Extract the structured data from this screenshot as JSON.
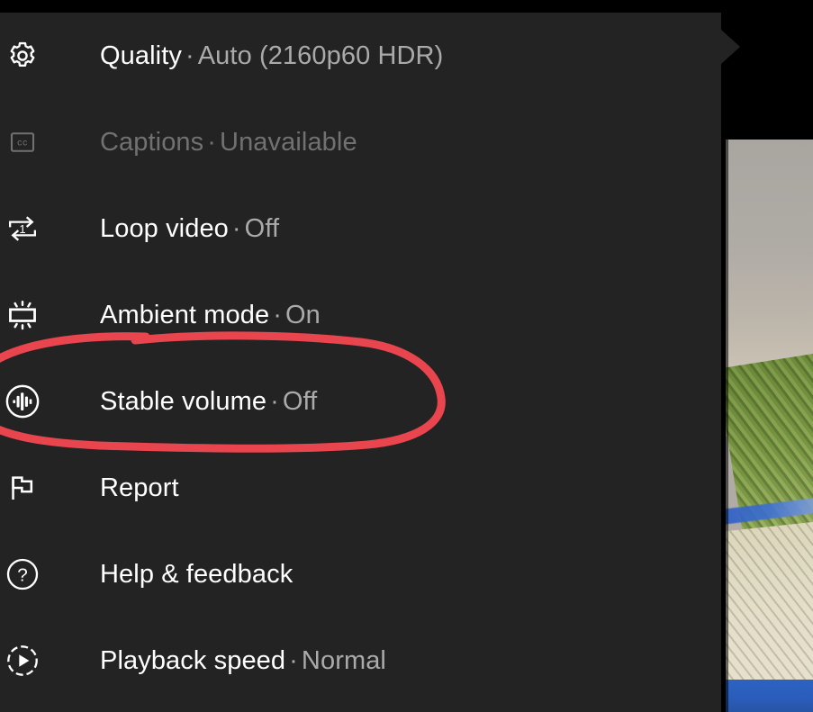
{
  "app": {
    "title": "YouTube player settings menu",
    "panel_background": "#232323",
    "text_color": "#ffffff",
    "value_color": "#aaaaaa",
    "disabled_color": "#717171"
  },
  "menu": {
    "items": [
      {
        "icon": "gear-icon",
        "label": "Quality",
        "separator": "·",
        "value": "Auto (2160p60 HDR)",
        "disabled": false
      },
      {
        "icon": "closed-captions-icon",
        "label": "Captions",
        "separator": "·",
        "value": "Unavailable",
        "disabled": true
      },
      {
        "icon": "loop-one-icon",
        "label": "Loop video",
        "separator": "·",
        "value": "Off",
        "disabled": false
      },
      {
        "icon": "ambient-mode-icon",
        "label": "Ambient mode",
        "separator": "·",
        "value": "On",
        "disabled": false
      },
      {
        "icon": "stable-volume-icon",
        "label": "Stable volume",
        "separator": "·",
        "value": "Off",
        "disabled": false
      },
      {
        "icon": "flag-icon",
        "label": "Report",
        "separator": "",
        "value": "",
        "disabled": false
      },
      {
        "icon": "help-circle-icon",
        "label": "Help & feedback",
        "separator": "",
        "value": "",
        "disabled": false
      },
      {
        "icon": "playback-speed-icon",
        "label": "Playback speed",
        "separator": "·",
        "value": "Normal",
        "disabled": false
      }
    ]
  },
  "annotation": {
    "shape": "hand-drawn-ellipse",
    "color": "#e8454e",
    "target": "Stable volume · Off"
  }
}
